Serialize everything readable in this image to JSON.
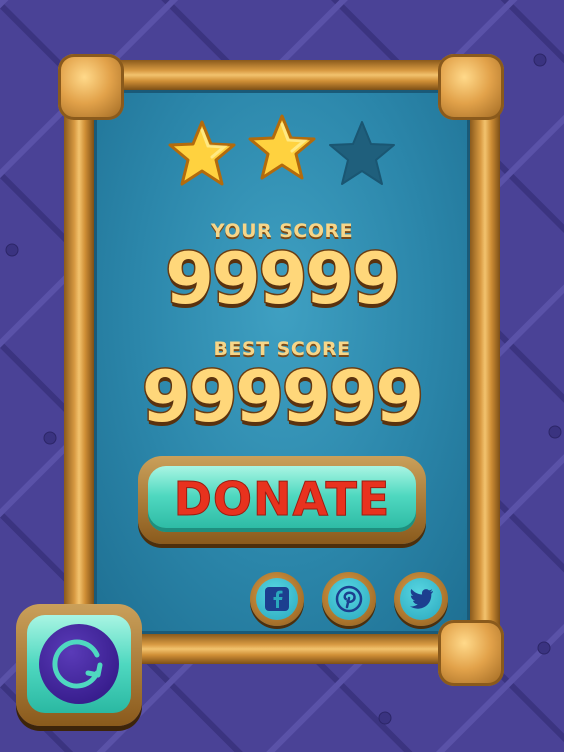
{
  "stars": {
    "earned": 2,
    "total": 3,
    "filled_color": "#ffd23f",
    "empty_color": "#1f5f7c"
  },
  "your_score": {
    "label": "YOUR SCORE",
    "value": "99999"
  },
  "best_score": {
    "label": "BEST SCORE",
    "value": "999999"
  },
  "donate_button": {
    "label": "DONATE"
  },
  "social": [
    {
      "icon": "facebook-icon"
    },
    {
      "icon": "pinterest-icon"
    },
    {
      "icon": "twitter-icon"
    }
  ],
  "restart_button": {
    "icon": "restart-icon"
  },
  "colors": {
    "background": "#4a4296",
    "panel": "#2b86aa",
    "accent_teal": "#4fd8c0",
    "donate_text": "#e8321e",
    "copper": "#d89a42"
  }
}
